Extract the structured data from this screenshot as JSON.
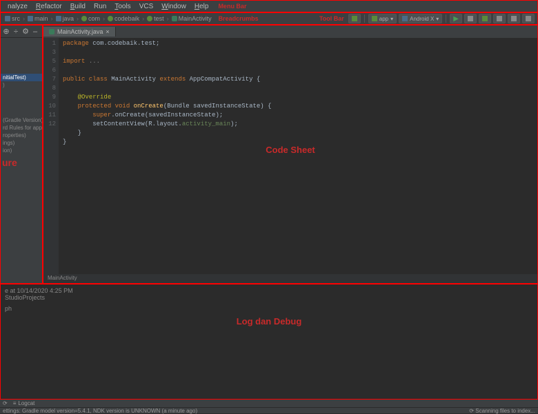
{
  "annotations": {
    "menu_bar": "Menu Bar",
    "breadcrumbs": "Breadcrumbs",
    "tool_bar": "Tool Bar",
    "structure": "ure",
    "code_sheet": "Code Sheet",
    "log_debug": "Log dan Debug"
  },
  "menubar": {
    "items": [
      {
        "u": "",
        "rest": "nalyze"
      },
      {
        "u": "R",
        "rest": "efactor"
      },
      {
        "u": "B",
        "rest": "uild"
      },
      {
        "u": "",
        "rest": "Run"
      },
      {
        "u": "T",
        "rest": "ools"
      },
      {
        "u": "",
        "rest": "VCS"
      },
      {
        "u": "W",
        "rest": "indow"
      },
      {
        "u": "H",
        "rest": "elp"
      }
    ]
  },
  "breadcrumbs": {
    "items": [
      {
        "icon": "folder",
        "label": "src"
      },
      {
        "icon": "folder",
        "label": "main"
      },
      {
        "icon": "folder",
        "label": "java"
      },
      {
        "icon": "pkg",
        "label": "com"
      },
      {
        "icon": "pkg",
        "label": "codebaik"
      },
      {
        "icon": "pkg",
        "label": "test"
      },
      {
        "icon": "file",
        "label": "MainActivity"
      }
    ]
  },
  "toolbar": {
    "module_label": "app",
    "device_label": "Android X",
    "hammer_title": "Build",
    "dropdown_caret": "▾"
  },
  "left_panel": {
    "top_icons": [
      "⊕",
      "÷",
      "⚙",
      "–"
    ],
    "tree": [
      {
        "label": "",
        "sel": false
      },
      {
        "label": "nitialTest)",
        "sel": true
      },
      {
        "label": ")",
        "sel": false
      }
    ],
    "scripts": [
      "(Gradle Version)",
      "rd Rules for app)",
      "roperties)",
      "ings)",
      "ion)"
    ]
  },
  "editor": {
    "tab": {
      "label": "MainActivity.java",
      "close": "×"
    },
    "line_numbers": [
      "1",
      "",
      "3",
      "",
      "5",
      "6",
      "7",
      "8",
      "9",
      "10",
      "11",
      "12",
      "",
      ""
    ],
    "code_lines": [
      {
        "t": "package",
        "r": " com.codebaik.test;"
      },
      {
        "blank": true
      },
      {
        "t": "import",
        "r": " ",
        "dim": "..."
      },
      {
        "blank": true
      },
      {
        "txt": "public class MainActivity extends AppCompatActivity {"
      },
      {
        "blank": true
      },
      {
        "indent": 1,
        "ann": "@Override"
      },
      {
        "indent": 1,
        "txt": "protected void onCreate(Bundle savedInstanceState) {"
      },
      {
        "indent": 2,
        "txt": "super.onCreate(savedInstanceState);"
      },
      {
        "indent": 2,
        "txt": "setContentView(R.layout.activity_main);"
      },
      {
        "indent": 1,
        "txt": "}"
      },
      {
        "txt": "}"
      }
    ],
    "bottom_crumb": "MainActivity"
  },
  "log": {
    "line1": "e at 10/14/2020 4:25 PM",
    "line2": "StudioProjects",
    "line3": "ph"
  },
  "statusbar": {
    "sync_tab": "Sync",
    "logcat_tab": "Logcat",
    "message": "ettings: Gradle model version=5.4.1, NDK version is UNKNOWN (a minute ago)",
    "scanning": "Scanning files to index..."
  }
}
